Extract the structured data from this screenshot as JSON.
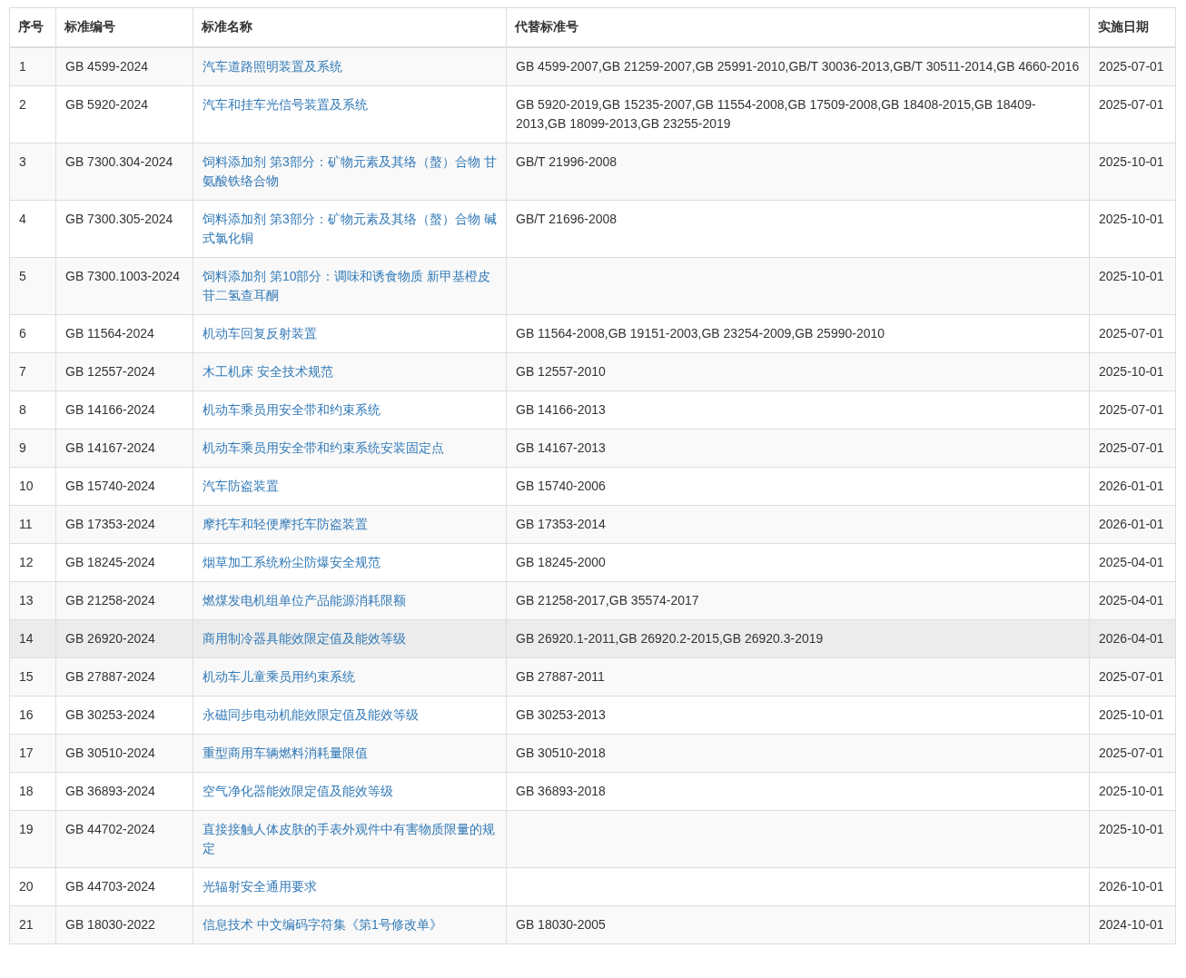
{
  "table": {
    "columns": [
      "序号",
      "标准编号",
      "标准名称",
      "代替标准号",
      "实施日期"
    ],
    "rows": [
      {
        "index": "1",
        "code": "GB 4599-2024",
        "name": "汽车道路照明装置及系统",
        "replaces": "GB 4599-2007,GB 21259-2007,GB 25991-2010,GB/T 30036-2013,GB/T 30511-2014,GB 4660-2016",
        "date": "2025-07-01",
        "highlighted": false
      },
      {
        "index": "2",
        "code": "GB 5920-2024",
        "name": "汽车和挂车光信号装置及系统",
        "replaces": "GB 5920-2019,GB 15235-2007,GB 11554-2008,GB 17509-2008,GB 18408-2015,GB 18409-2013,GB 18099-2013,GB 23255-2019",
        "date": "2025-07-01",
        "highlighted": false
      },
      {
        "index": "3",
        "code": "GB 7300.304-2024",
        "name": "饲料添加剂 第3部分：矿物元素及其络（螯）合物 甘氨酸铁络合物",
        "replaces": "GB/T 21996-2008",
        "date": "2025-10-01",
        "highlighted": false
      },
      {
        "index": "4",
        "code": "GB 7300.305-2024",
        "name": "饲料添加剂 第3部分：矿物元素及其络（螯）合物 碱式氯化铜",
        "replaces": "GB/T 21696-2008",
        "date": "2025-10-01",
        "highlighted": false
      },
      {
        "index": "5",
        "code": "GB 7300.1003-2024",
        "name": "饲料添加剂 第10部分：调味和诱食物质 新甲基橙皮苷二氢查耳酮",
        "date": "2025-10-01",
        "highlighted": false
      },
      {
        "index": "6",
        "code": "GB 11564-2024",
        "name": "机动车回复反射装置",
        "replaces": "GB 11564-2008,GB 19151-2003,GB 23254-2009,GB 25990-2010",
        "date": "2025-07-01",
        "highlighted": false
      },
      {
        "index": "7",
        "code": "GB 12557-2024",
        "name": "木工机床 安全技术规范",
        "replaces": "GB 12557-2010",
        "date": "2025-10-01",
        "highlighted": false
      },
      {
        "index": "8",
        "code": "GB 14166-2024",
        "name": "机动车乘员用安全带和约束系统",
        "replaces": "GB 14166-2013",
        "date": "2025-07-01",
        "highlighted": false
      },
      {
        "index": "9",
        "code": "GB 14167-2024",
        "name": "机动车乘员用安全带和约束系统安装固定点",
        "replaces": "GB 14167-2013",
        "date": "2025-07-01",
        "highlighted": false
      },
      {
        "index": "10",
        "code": "GB 15740-2024",
        "name": "汽车防盗装置",
        "replaces": "GB 15740-2006",
        "date": "2026-01-01",
        "highlighted": false
      },
      {
        "index": "11",
        "code": "GB 17353-2024",
        "name": "摩托车和轻便摩托车防盗装置",
        "replaces": "GB 17353-2014",
        "date": "2026-01-01",
        "highlighted": false
      },
      {
        "index": "12",
        "code": "GB 18245-2024",
        "name": "烟草加工系统粉尘防爆安全规范",
        "replaces": "GB 18245-2000",
        "date": "2025-04-01",
        "highlighted": false
      },
      {
        "index": "13",
        "code": "GB 21258-2024",
        "name": "燃煤发电机组单位产品能源消耗限额",
        "replaces": "GB 21258-2017,GB 35574-2017",
        "date": "2025-04-01",
        "highlighted": false
      },
      {
        "index": "14",
        "code": "GB 26920-2024",
        "name": "商用制冷器具能效限定值及能效等级",
        "replaces": "GB 26920.1-2011,GB 26920.2-2015,GB 26920.3-2019",
        "date": "2026-04-01",
        "highlighted": true
      },
      {
        "index": "15",
        "code": "GB 27887-2024",
        "name": "机动车儿童乘员用约束系统",
        "replaces": "GB 27887-2011",
        "date": "2025-07-01",
        "highlighted": false
      },
      {
        "index": "16",
        "code": "GB 30253-2024",
        "name": "永磁同步电动机能效限定值及能效等级",
        "replaces": "GB 30253-2013",
        "date": "2025-10-01",
        "highlighted": false
      },
      {
        "index": "17",
        "code": "GB 30510-2024",
        "name": "重型商用车辆燃料消耗量限值",
        "replaces": "GB 30510-2018",
        "date": "2025-07-01",
        "highlighted": false
      },
      {
        "index": "18",
        "code": "GB 36893-2024",
        "name": "空气净化器能效限定值及能效等级",
        "replaces": "GB 36893-2018",
        "date": "2025-10-01",
        "highlighted": false
      },
      {
        "index": "19",
        "code": "GB 44702-2024",
        "name": "直接接触人体皮肤的手表外观件中有害物质限量的规定",
        "date": "2025-10-01",
        "highlighted": false
      },
      {
        "index": "20",
        "code": "GB 44703-2024",
        "name": "光辐射安全通用要求",
        "date": "2026-10-01",
        "highlighted": false
      },
      {
        "index": "21",
        "code": "GB 18030-2022",
        "name": "信息技术 中文编码字符集《第1号修改单》",
        "replaces": "GB 18030-2005",
        "date": "2024-10-01",
        "highlighted": false
      }
    ]
  }
}
